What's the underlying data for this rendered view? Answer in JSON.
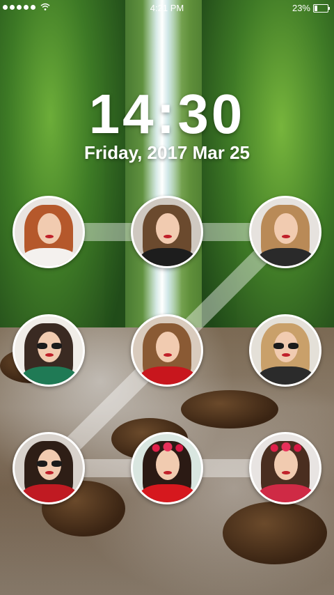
{
  "status_bar": {
    "time": "4:21 PM",
    "battery_percent": "23%",
    "battery_level": 0.23,
    "signal_icon": "signal-dots-icon",
    "wifi_icon": "wifi-icon"
  },
  "lock_screen": {
    "clock": "14:30",
    "date": "Friday, 2017 Mar 25"
  },
  "pattern": {
    "grid": "3x3",
    "photo_dots": [
      {
        "name": "pattern-dot-1",
        "bg": "#e9e4e0",
        "hair": "#b5582b",
        "body": "#f4f1ee",
        "accessory": "none"
      },
      {
        "name": "pattern-dot-2",
        "bg": "#cfc8c0",
        "hair": "#6b4a2e",
        "body": "#1d1d1d",
        "accessory": "none"
      },
      {
        "name": "pattern-dot-3",
        "bg": "#e6e2de",
        "hair": "#b98a57",
        "body": "#2a2a2a",
        "accessory": "none"
      },
      {
        "name": "pattern-dot-4",
        "bg": "#f0ede8",
        "hair": "#3a2a22",
        "body": "#1f7a55",
        "accessory": "sunglasses"
      },
      {
        "name": "pattern-dot-5",
        "bg": "#d9cbbd",
        "hair": "#8a5a34",
        "body": "#c8161d",
        "accessory": "none"
      },
      {
        "name": "pattern-dot-6",
        "bg": "#e4e0d8",
        "hair": "#c9a06a",
        "body": "#2b2b2b",
        "accessory": "sunglasses"
      },
      {
        "name": "pattern-dot-7",
        "bg": "#d8d2cc",
        "hair": "#2e1e16",
        "body": "#c01a22",
        "accessory": "sunglasses"
      },
      {
        "name": "pattern-dot-8",
        "bg": "#d9e6e0",
        "hair": "#2b1a14",
        "body": "#d6181e",
        "accessory": "flower-crown"
      },
      {
        "name": "pattern-dot-9",
        "bg": "#e8e4e2",
        "hair": "#4a2e20",
        "body": "#cf2a45",
        "accessory": "flower-crown"
      }
    ],
    "traced_sequence": [
      1,
      2,
      3,
      5,
      7,
      8,
      9
    ]
  }
}
